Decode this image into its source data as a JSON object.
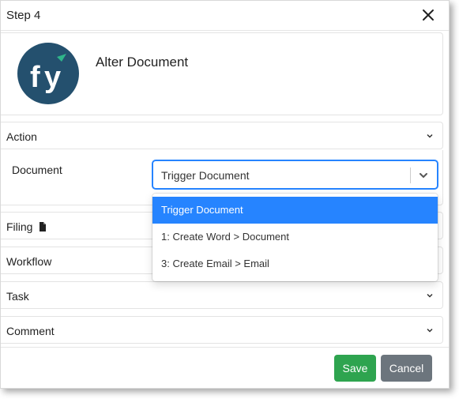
{
  "modal": {
    "title": "Step 4",
    "close_label": "×"
  },
  "card": {
    "title": "Alter Document",
    "logo_text": "fy",
    "brand_color": "#24506e",
    "accent_color": "#2fb58a"
  },
  "sections": {
    "action": "Action",
    "filing": "Filing",
    "workflow": "Workflow",
    "task": "Task",
    "comment": "Comment"
  },
  "action": {
    "document_label": "Document",
    "document_value": "Trigger Document"
  },
  "dropdown": {
    "options": [
      {
        "label": "Trigger Document",
        "selected": true
      },
      {
        "label": "1: Create Word > Document",
        "selected": false
      },
      {
        "label": "3: Create Email > Email",
        "selected": false
      }
    ]
  },
  "footer": {
    "save_label": "Save",
    "cancel_label": "Cancel"
  },
  "colors": {
    "select_focus": "#2684ff",
    "save": "#2ea44f",
    "cancel": "#6c757d"
  }
}
